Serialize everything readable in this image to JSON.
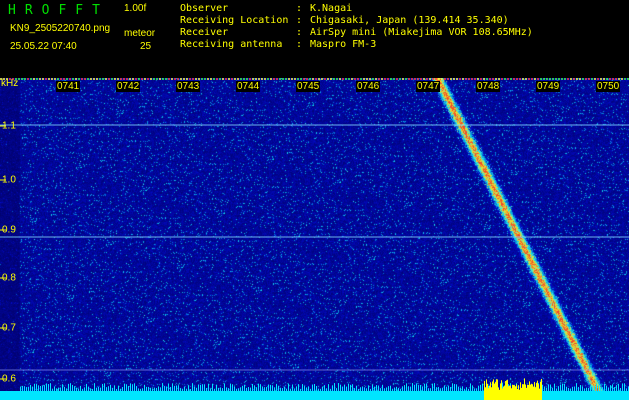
{
  "header": {
    "app_title": "HROFFT",
    "app_version": "1.00f",
    "filename": "KN9_2505220740.png",
    "mode_label": "meteor",
    "datetime": "25.05.22 07:40",
    "mode_value": "25",
    "info": [
      {
        "label": "Observer",
        "value": "K.Nagai"
      },
      {
        "label": "Receiving Location",
        "value": "Chigasaki, Japan (139.414 35.340)"
      },
      {
        "label": "Receiver",
        "value": "AirSpy mini (Miakejima VOR 108.65MHz)"
      },
      {
        "label": "Receiving antenna",
        "value": "Maspro FM-3"
      }
    ]
  },
  "spectrogram": {
    "y_unit": "kHz",
    "y_ticks": [
      "1.1",
      "1.0",
      "0.9",
      "0.8",
      "0.7",
      "0.6"
    ],
    "time_labels": [
      "0741",
      "0742",
      "0743",
      "0744",
      "0745",
      "0746",
      "0747",
      "0748",
      "0749",
      "0750"
    ],
    "colors": {
      "background": "#02063a",
      "text": "#ffff00",
      "baseline": "#00e5ff",
      "burst": "#ffff00",
      "carrier_line": "#7fd4ff"
    }
  }
}
